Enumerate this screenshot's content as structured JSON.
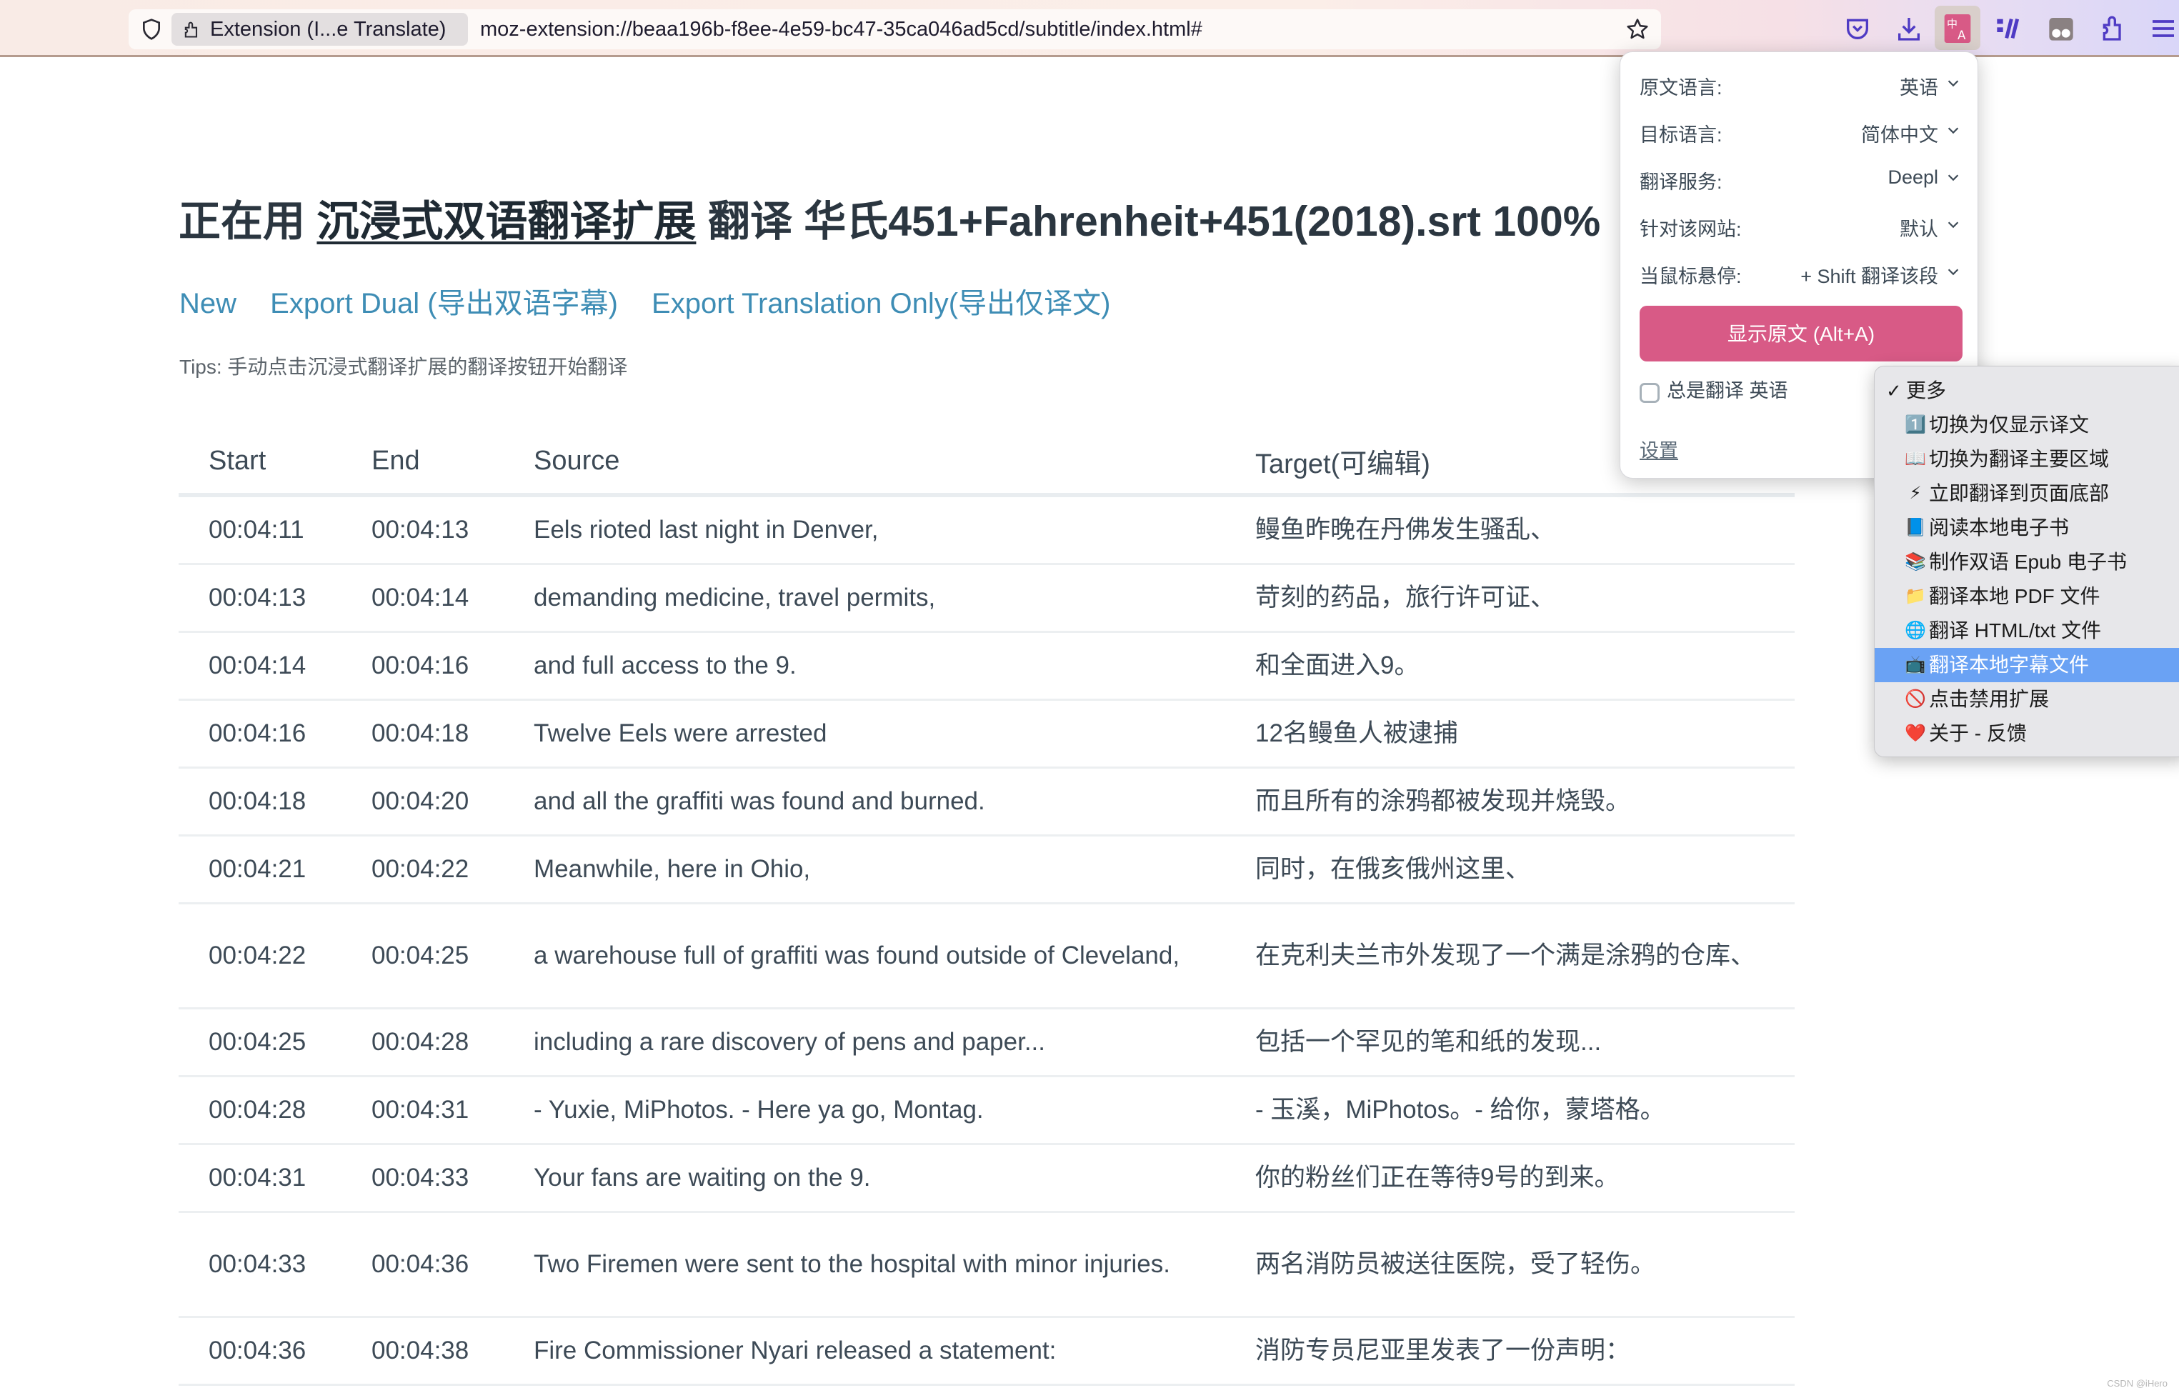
{
  "browser": {
    "tab_chip_label": "Extension (I...e Translate)",
    "url": "moz-extension://beaa196b-f8ee-4e59-bc47-35ca046ad5cd/subtitle/index.html#",
    "toolbar_icons": [
      "pocket-icon",
      "download-icon",
      "translate-extension-icon",
      "simple-translate-icon",
      "tracker-icon",
      "extensions-icon",
      "menu-icon"
    ],
    "accent_color": "#d85a86"
  },
  "page": {
    "title_prefix": "正在用 ",
    "title_link": "沉浸式双语翻译扩展",
    "title_suffix": " 翻译 华氏451+Fahrenheit+451(2018).srt 100%",
    "links": {
      "new": "New",
      "export_dual": "Export Dual (导出双语字幕)",
      "export_translation": "Export Translation Only(导出仅译文)"
    },
    "tips": "Tips: 手动点击沉浸式翻译扩展的翻译按钮开始翻译",
    "link_color": "#3e8db5"
  },
  "table": {
    "headers": [
      "Start",
      "End",
      "Source",
      "Target(可编辑)"
    ],
    "rows": [
      {
        "start": "00:04:11",
        "end": "00:04:13",
        "source": "Eels rioted last night in Denver,",
        "target": "鳗鱼昨晚在丹佛发生骚乱、"
      },
      {
        "start": "00:04:13",
        "end": "00:04:14",
        "source": "demanding medicine, travel permits,",
        "target": "苛刻的药品，旅行许可证、"
      },
      {
        "start": "00:04:14",
        "end": "00:04:16",
        "source": "and full access to the 9.",
        "target": "和全面进入9。"
      },
      {
        "start": "00:04:16",
        "end": "00:04:18",
        "source": "Twelve Eels were arrested",
        "target": "12名鳗鱼人被逮捕"
      },
      {
        "start": "00:04:18",
        "end": "00:04:20",
        "source": "and all the graffiti was found and burned.",
        "target": "而且所有的涂鸦都被发现并烧毁。"
      },
      {
        "start": "00:04:21",
        "end": "00:04:22",
        "source": "Meanwhile, here in Ohio,",
        "target": "同时，在俄亥俄州这里、"
      },
      {
        "start": "00:04:22",
        "end": "00:04:25",
        "source": "a warehouse full of graffiti was found outside of Cleveland,",
        "target": "在克利夫兰市外发现了一个满是涂鸦的仓库、"
      },
      {
        "start": "00:04:25",
        "end": "00:04:28",
        "source": "including a rare discovery of pens and paper...",
        "target": "包括一个罕见的笔和纸的发现..."
      },
      {
        "start": "00:04:28",
        "end": "00:04:31",
        "source": "- Yuxie, MiPhotos. - Here ya go, Montag.",
        "target": "- 玉溪，MiPhotos。- 给你，蒙塔格。"
      },
      {
        "start": "00:04:31",
        "end": "00:04:33",
        "source": "Your fans are waiting on the 9.",
        "target": "你的粉丝们正在等待9号的到来。"
      },
      {
        "start": "00:04:33",
        "end": "00:04:36",
        "source": "Two Firemen were sent to the hospital with minor injuries.",
        "target": "两名消防员被送往医院，受了轻伤。"
      },
      {
        "start": "00:04:36",
        "end": "00:04:38",
        "source": "Fire Commissioner Nyari released a statement:",
        "target": "消防专员尼亚里发表了一份声明："
      }
    ]
  },
  "popup": {
    "rows": [
      {
        "label": "原文语言:",
        "value": "英语"
      },
      {
        "label": "目标语言:",
        "value": "简体中文"
      },
      {
        "label": "翻译服务:",
        "value": "Deepl"
      },
      {
        "label": "针对该网站:",
        "value": "默认"
      },
      {
        "label": "当鼠标悬停:",
        "value": "+ Shift 翻译该段"
      }
    ],
    "show_original_button": "显示原文 (Alt+A)",
    "always_translate_label": "总是翻译 英语",
    "always_translate_checked": false,
    "settings_link": "设置"
  },
  "context_menu": {
    "items": [
      {
        "icon": "✓",
        "icon_name": "checkmark-icon",
        "label": "更多",
        "checked": true
      },
      {
        "icon": "1️⃣",
        "icon_name": "keycap-one-icon",
        "label": "切换为仅显示译文"
      },
      {
        "icon": "📖",
        "icon_name": "open-book-icon",
        "label": "切换为翻译主要区域"
      },
      {
        "icon": "⚡",
        "icon_name": "lightning-icon",
        "label": "立即翻译到页面底部"
      },
      {
        "icon": "📘",
        "icon_name": "blue-book-icon",
        "label": "阅读本地电子书"
      },
      {
        "icon": "📚",
        "icon_name": "books-icon",
        "label": "制作双语 Epub 电子书"
      },
      {
        "icon": "📁",
        "icon_name": "folder-icon",
        "label": "翻译本地 PDF 文件"
      },
      {
        "icon": "🌐",
        "icon_name": "globe-icon",
        "label": "翻译 HTML/txt 文件"
      },
      {
        "icon": "📺",
        "icon_name": "television-icon",
        "label": "翻译本地字幕文件",
        "highlighted": true
      },
      {
        "icon": "🚫",
        "icon_name": "prohibited-icon",
        "label": "点击禁用扩展"
      },
      {
        "icon": "❤️",
        "icon_name": "heart-icon",
        "label": "关于 - 反馈"
      }
    ]
  },
  "watermark": "CSDN @iHero"
}
